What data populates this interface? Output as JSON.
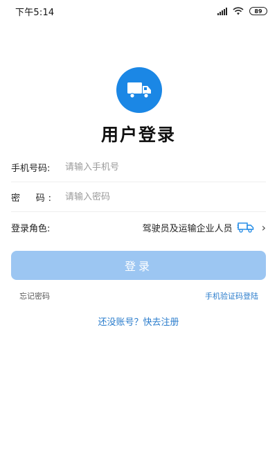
{
  "status_bar": {
    "time": "下午5:14",
    "battery": "89"
  },
  "page": {
    "title": "用户登录"
  },
  "form": {
    "phone": {
      "label": "手机号码:",
      "placeholder": "请输入手机号",
      "value": ""
    },
    "password": {
      "label_first": "密",
      "label_last": "码:",
      "placeholder": "请输入密码",
      "value": ""
    },
    "role": {
      "label": "登录角色:",
      "value": "驾驶员及运输企业人员"
    }
  },
  "actions": {
    "login_label": "登录",
    "forgot_password": "忘记密码",
    "sms_login": "手机验证码登陆",
    "register": "还没账号？快去注册"
  },
  "colors": {
    "brand": "#1b87e5",
    "login_button": "#9cc6f2",
    "link": "#2a7ccc"
  },
  "icons": {
    "logo": "truck-icon",
    "role": "truck-icon",
    "role_chevron": "chevron-right-icon"
  }
}
